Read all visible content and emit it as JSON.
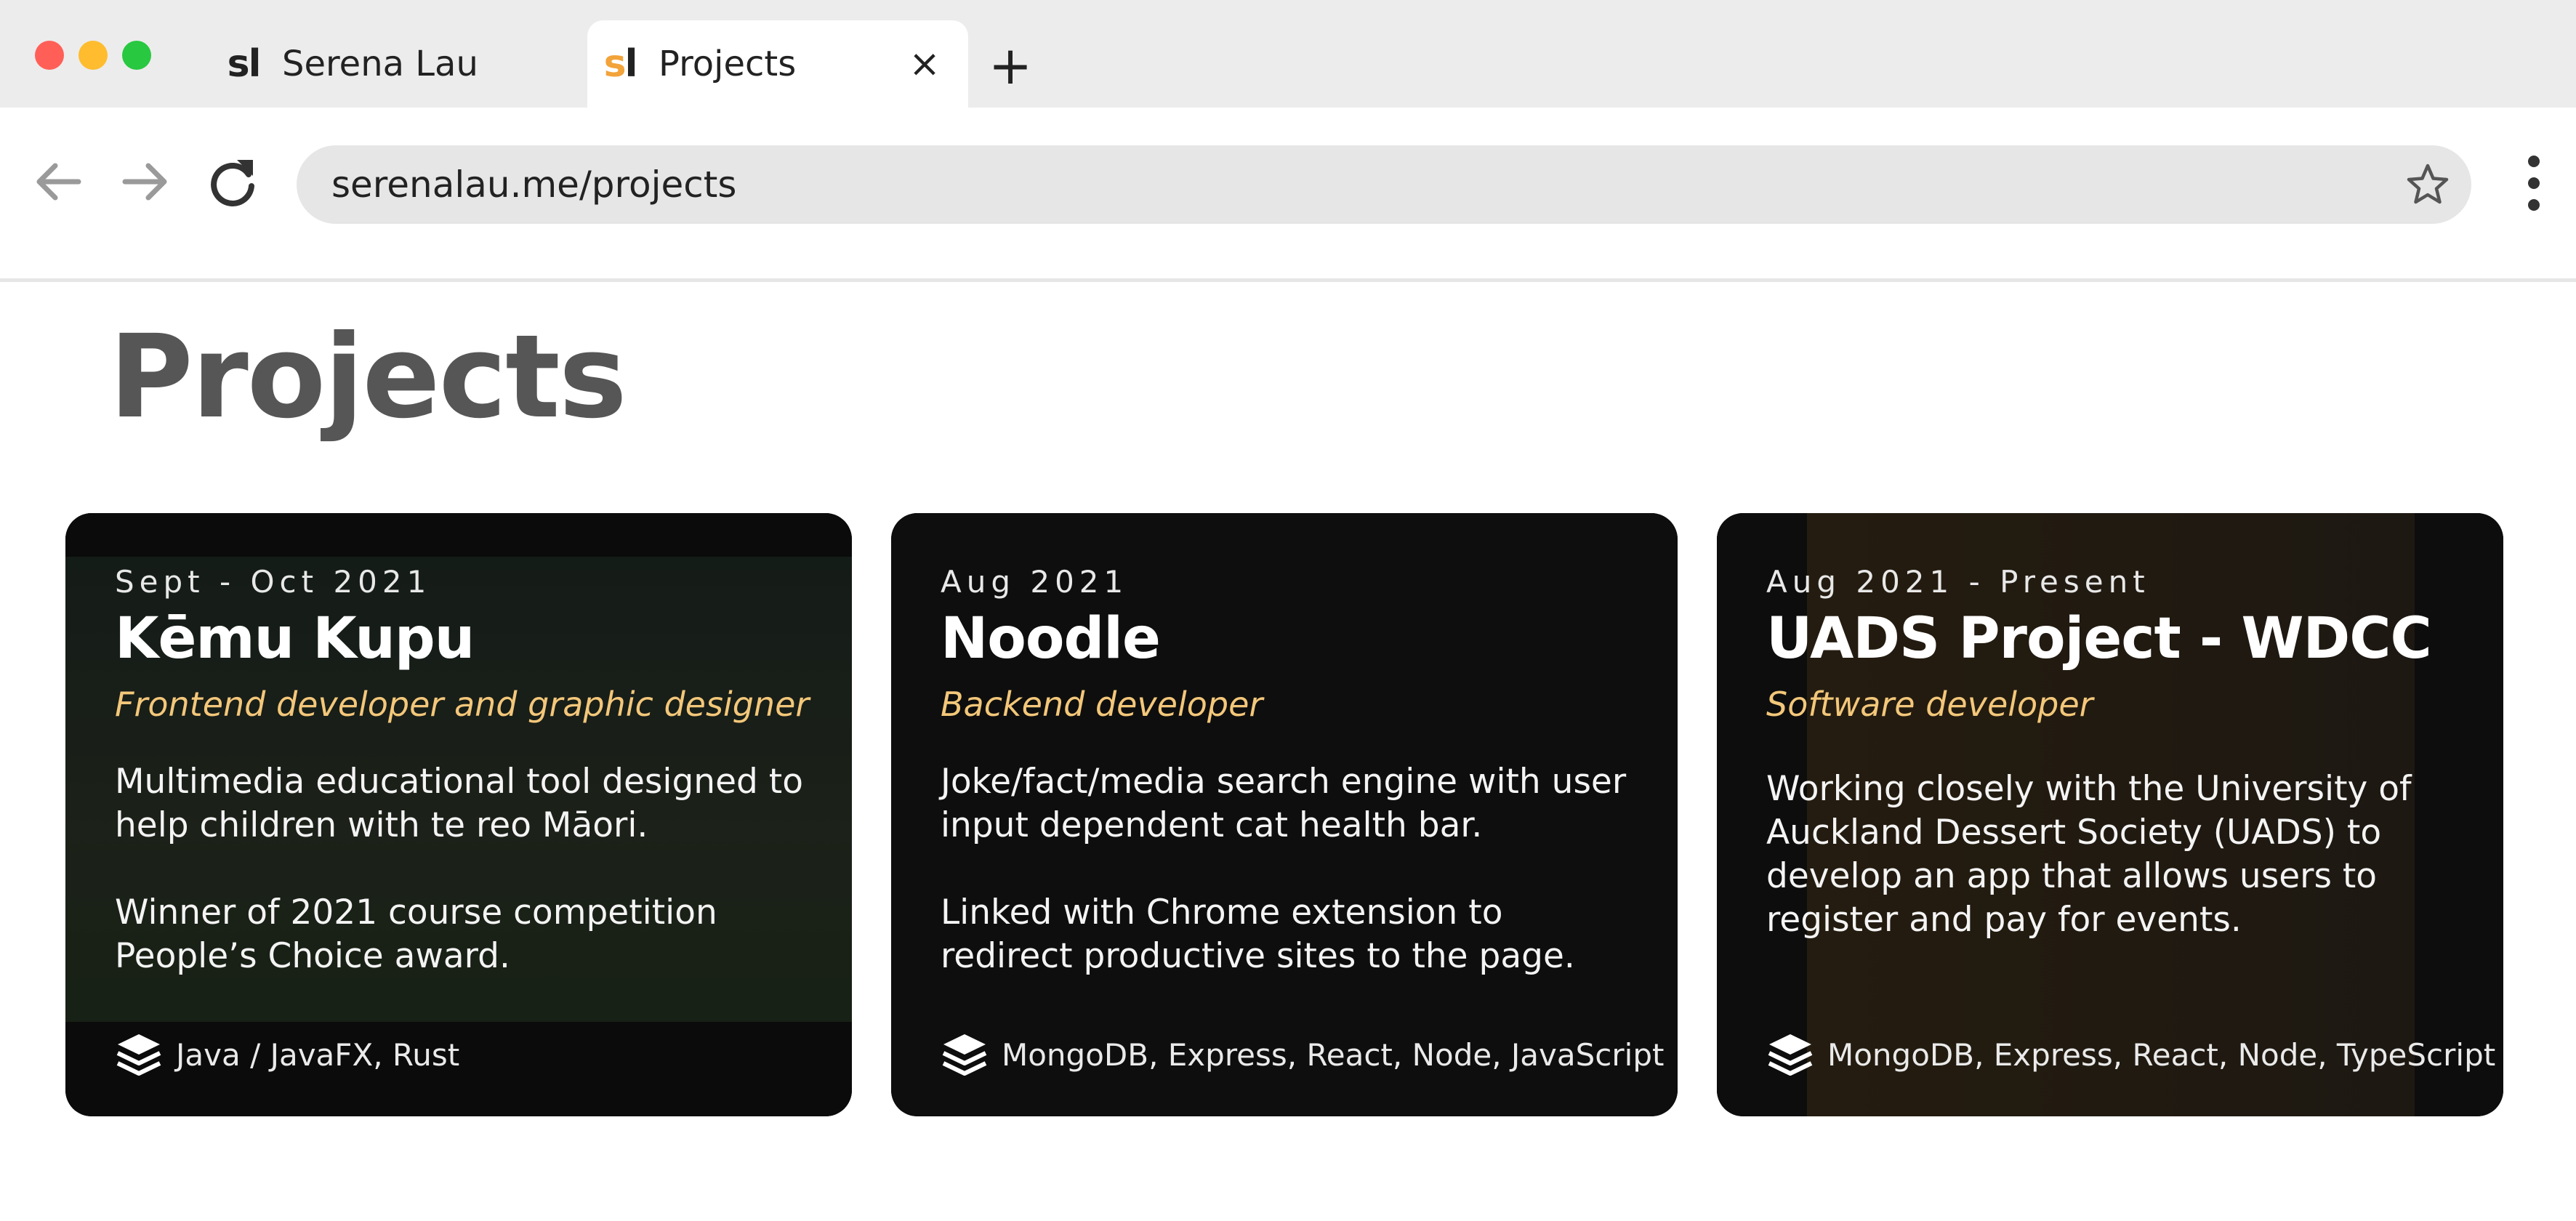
{
  "browser": {
    "tabs": [
      {
        "favicon": "sl",
        "label": "Serena Lau",
        "active": false
      },
      {
        "favicon": "sl",
        "label": "Projects",
        "active": true
      }
    ],
    "close_tab_glyph": "×",
    "new_tab_glyph": "+",
    "url": "serenalau.me/projects",
    "icons": [
      "back-arrow-icon",
      "forward-arrow-icon",
      "reload-icon",
      "star-icon",
      "more-vert-icon"
    ],
    "traffic_light_colors": [
      "#ff5f57",
      "#febc2e",
      "#28c840"
    ]
  },
  "page": {
    "title": "Projects",
    "accent_color": "#f3c77a",
    "projects": [
      {
        "date": "Sept - Oct 2021",
        "title": "Kēmu Kupu",
        "role": "Frontend developer and graphic designer",
        "description": [
          "Multimedia educational tool designed to help children with te reo Māori.",
          "Winner of 2021 course competition People’s Choice award."
        ],
        "stack_icon": "layers-icon",
        "stack": "Java / JavaFX, Rust"
      },
      {
        "date": "Aug 2021",
        "title": "Noodle",
        "role": "Backend developer",
        "description": [
          "Joke/fact/media search engine with user input dependent cat health bar.",
          "Linked with Chrome extension to redirect productive sites to the page."
        ],
        "stack_icon": "layers-icon",
        "stack": "MongoDB, Express, React, Node, JavaScript"
      },
      {
        "date": "Aug 2021 - Present",
        "title": "UADS Project - WDCC",
        "role": "Software developer",
        "description": [
          "Working closely with the University of Auckland Dessert Society (UADS) to develop an app that allows users to register and pay for events."
        ],
        "stack_icon": "layers-icon",
        "stack": "MongoDB, Express, React, Node, TypeScript"
      }
    ]
  }
}
